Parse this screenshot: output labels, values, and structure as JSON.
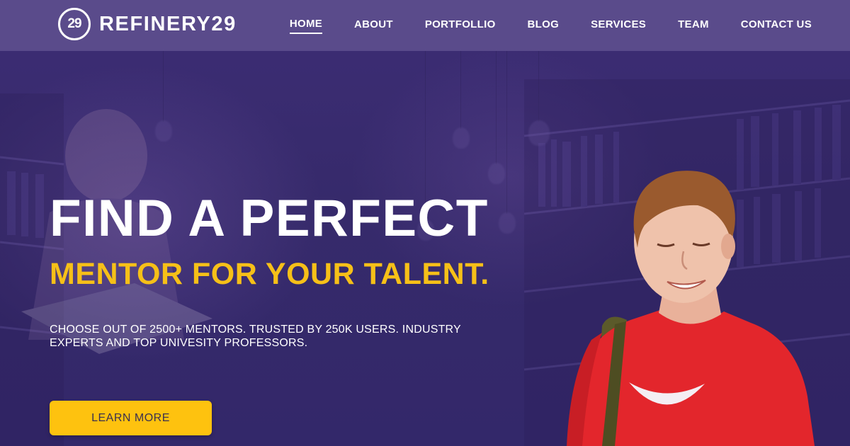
{
  "brand": {
    "logo_mark": "29",
    "name": "REFINERY29"
  },
  "nav": {
    "items": [
      {
        "label": "HOME",
        "active": true
      },
      {
        "label": "ABOUT",
        "active": false
      },
      {
        "label": "PORTFOLLIO",
        "active": false
      },
      {
        "label": "BLOG",
        "active": false
      },
      {
        "label": "SERVICES",
        "active": false
      },
      {
        "label": "TEAM",
        "active": false
      },
      {
        "label": "CONTACT US",
        "active": false
      }
    ]
  },
  "hero": {
    "title": "FIND A PERFECT",
    "subtitle": "MENTOR FOR YOUR TALENT.",
    "description": "CHOOSE OUT OF 2500+ MENTORS. TRUSTED BY 250K USERS. INDUSTRY EXPERTS AND TOP UNIVESITY PROFESSORS.",
    "cta_label": "LEARN MORE"
  },
  "colors": {
    "nav_bg": "#5a4b8b",
    "hero_bg": "#3a2a6e",
    "accent_yellow": "#f6c018",
    "button_bg": "#fec20f"
  }
}
